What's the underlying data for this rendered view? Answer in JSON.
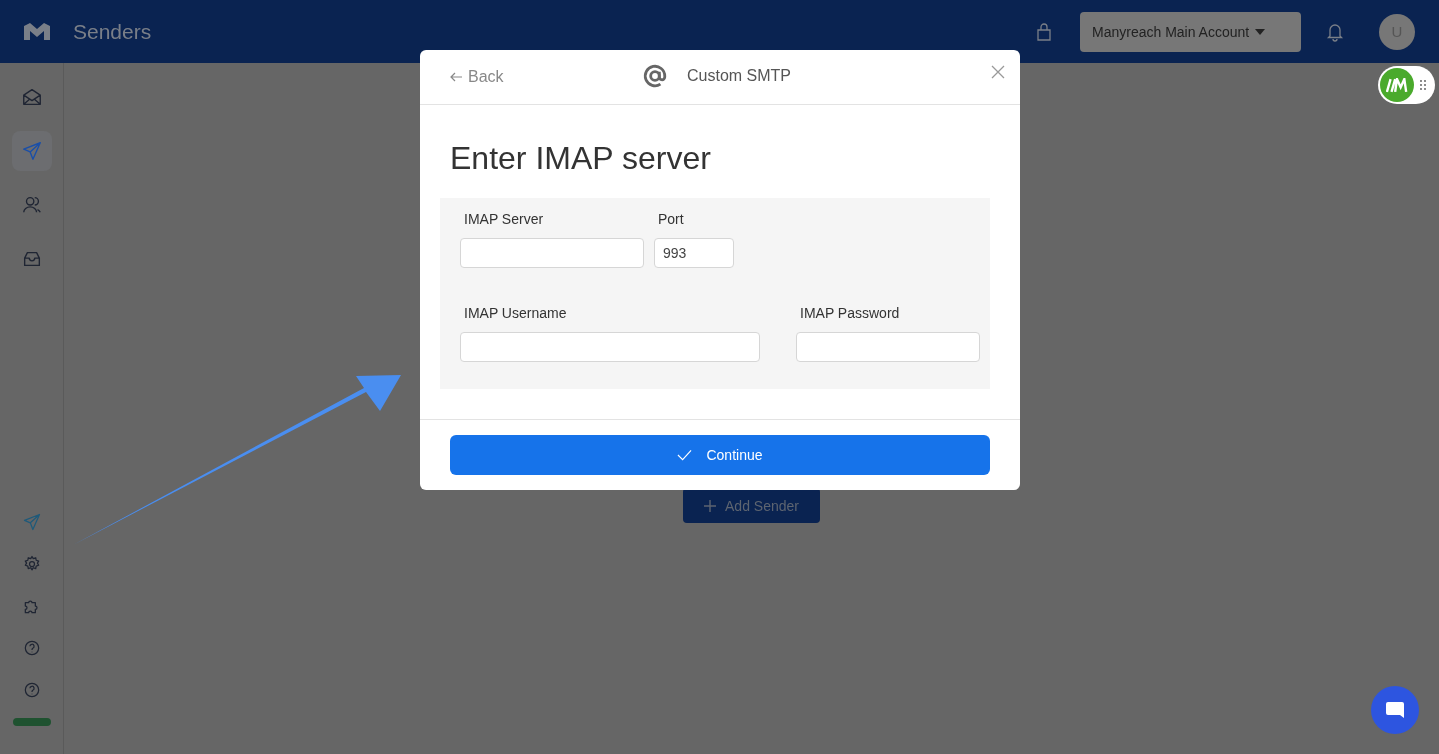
{
  "header": {
    "title": "Senders",
    "account_menu": "Manyreach Main Account",
    "avatar": "U"
  },
  "sidebar": {
    "top_items": [
      {
        "kind": "mail",
        "selected": false
      },
      {
        "kind": "send",
        "selected": true
      },
      {
        "kind": "users",
        "selected": false
      },
      {
        "kind": "inbox",
        "selected": false
      }
    ],
    "bottom_items": [
      {
        "kind": "send",
        "selected": false
      },
      {
        "kind": "gear",
        "selected": false
      },
      {
        "kind": "puzzle",
        "selected": false
      },
      {
        "kind": "help",
        "selected": false
      },
      {
        "kind": "help",
        "selected": false
      }
    ]
  },
  "main": {
    "add_sender": "Add Sender"
  },
  "modal": {
    "back": "Back",
    "title": "Custom SMTP",
    "heading": "Enter IMAP server",
    "field_rows": [
      [
        {
          "label": "IMAP Server"
        },
        {
          "label": "Port",
          "value": "993"
        }
      ],
      [
        {
          "label": "IMAP Username"
        },
        {
          "label": "IMAP Password"
        }
      ]
    ],
    "continue": "Continue"
  }
}
